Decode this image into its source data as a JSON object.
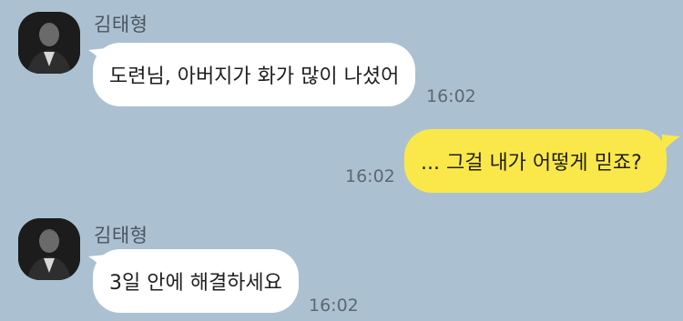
{
  "messages": [
    {
      "sender": "김태형",
      "text": "도련님, 아버지가 화가 많이 나셨어",
      "time": "16:02",
      "direction": "incoming"
    },
    {
      "text": "... 그걸 내가 어떻게 믿죠?",
      "time": "16:02",
      "direction": "outgoing"
    },
    {
      "sender": "김태형",
      "text": "3일 안에 해결하세요",
      "time": "16:02",
      "direction": "incoming"
    }
  ],
  "colors": {
    "background": "#abc1d1",
    "incoming_bubble": "#ffffff",
    "outgoing_bubble": "#fae84a"
  },
  "icons": {
    "avatar": "profile-photo"
  }
}
